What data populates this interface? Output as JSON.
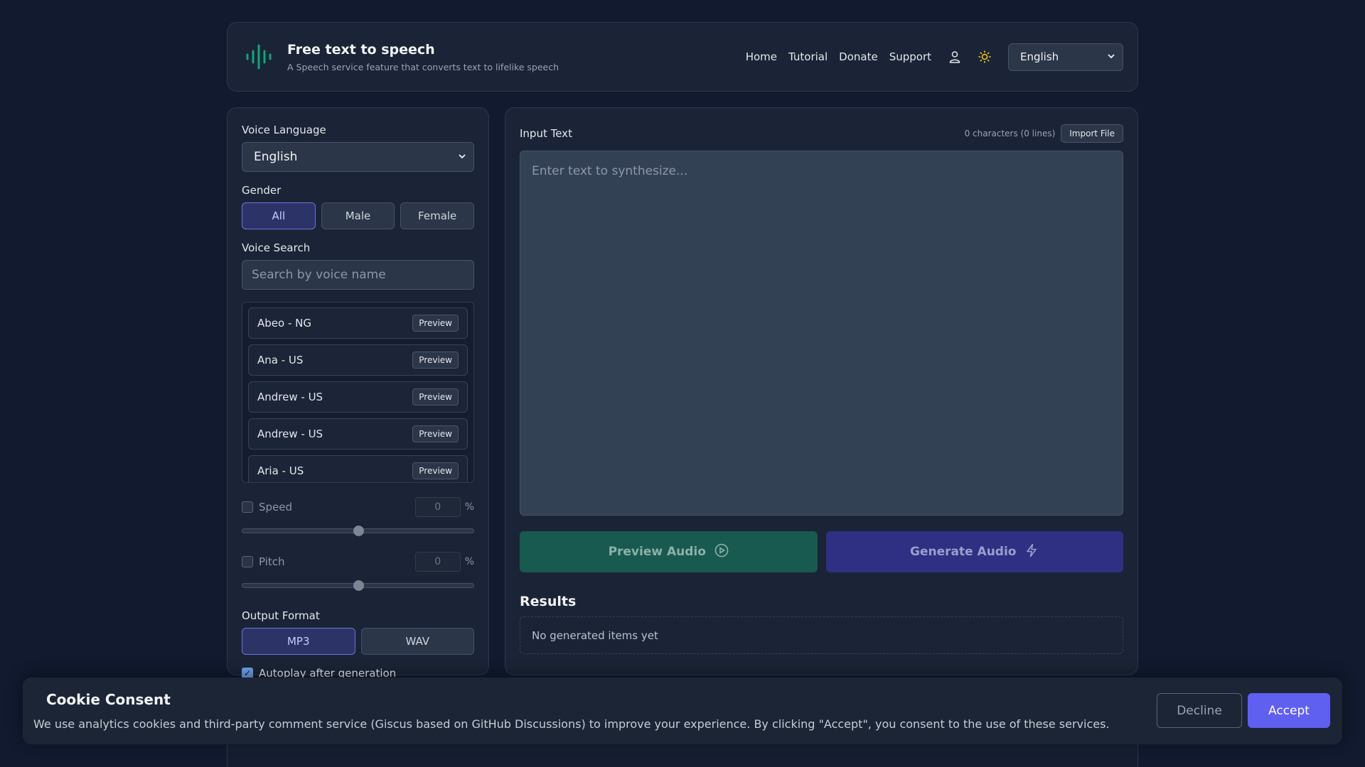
{
  "header": {
    "title": "Free text to speech",
    "subtitle": "A Speech service feature that converts text to lifelike speech",
    "nav": [
      "Home",
      "Tutorial",
      "Donate",
      "Support"
    ],
    "language": "English",
    "accent_color": "#16a37a"
  },
  "left": {
    "voice_language_label": "Voice Language",
    "voice_language_value": "English",
    "gender_label": "Gender",
    "gender_options": [
      "All",
      "Male",
      "Female"
    ],
    "gender_selected": "All",
    "voice_search_label": "Voice Search",
    "voice_search_placeholder": "Search by voice name",
    "voices": [
      {
        "name": "Abeo - NG",
        "action": "Preview"
      },
      {
        "name": "Ana - US",
        "action": "Preview"
      },
      {
        "name": "Andrew - US",
        "action": "Preview"
      },
      {
        "name": "Andrew - US",
        "action": "Preview"
      },
      {
        "name": "Aria - US",
        "action": "Preview"
      }
    ],
    "speed": {
      "label": "Speed",
      "value": "0",
      "unit": "%",
      "level": 0.5
    },
    "pitch": {
      "label": "Pitch",
      "value": "0",
      "unit": "%",
      "level": 0.5
    },
    "output_format_label": "Output Format",
    "formats": [
      "MP3",
      "WAV"
    ],
    "format_selected": "MP3",
    "autoplay_label": "Autoplay after generation",
    "autoplay_checked": true
  },
  "right": {
    "input_label": "Input Text",
    "char_count": "0 characters (0 lines)",
    "import_label": "Import File",
    "placeholder": "Enter text to synthesize...",
    "preview_label": "Preview Audio",
    "generate_label": "Generate Audio",
    "results_title": "Results",
    "results_empty": "No generated items yet"
  },
  "cookie": {
    "title": "Cookie Consent",
    "text": "We use analytics cookies and third-party comment service (Giscus based on GitHub Discussions) to improve your experience. By clicking \"Accept\", you consent to the use of these services.",
    "decline": "Decline",
    "accept": "Accept"
  }
}
